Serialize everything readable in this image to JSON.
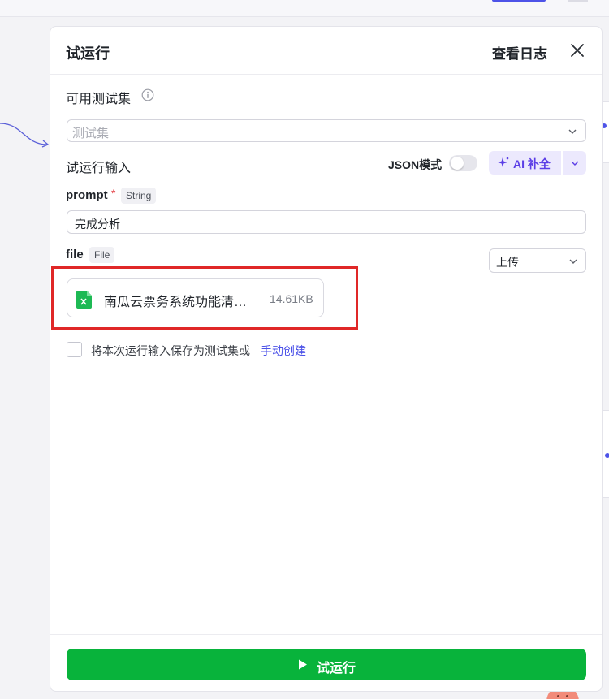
{
  "panel": {
    "title": "试运行",
    "view_log": "查看日志"
  },
  "test_set": {
    "label": "可用测试集",
    "placeholder": "测试集"
  },
  "run_input": {
    "label": "试运行输入",
    "json_mode_label": "JSON模式",
    "json_mode_on": false,
    "ai_fill_label": "AI 补全"
  },
  "fields": {
    "prompt": {
      "name": "prompt",
      "required_mark": "*",
      "type": "String",
      "value": "完成分析"
    },
    "file": {
      "name": "file",
      "type": "File",
      "source_select": "上传",
      "file_name": "南瓜云票务系统功能清…",
      "file_size": "14.61KB"
    }
  },
  "save_option": {
    "text": "将本次运行输入保存为测试集或",
    "link": "手动创建",
    "checked": false
  },
  "footer": {
    "run_button": "试运行"
  },
  "colors": {
    "accent": "#4d53e8",
    "run_green": "#08b33b",
    "ai_purple": "#5b3ee6",
    "highlight_red": "#e02828"
  },
  "icons": {
    "info": "info-circle-icon",
    "close": "close-icon",
    "chevron": "chevron-down-icon",
    "ai_star": "sparkle-icon",
    "file": "excel-file-icon",
    "play": "play-icon"
  }
}
